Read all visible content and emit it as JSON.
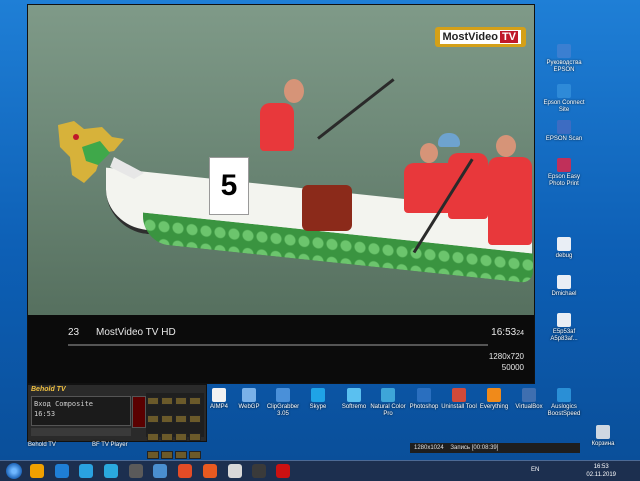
{
  "video": {
    "watermark_main": "MostVideo",
    "watermark_tv": "TV",
    "boat_number": "5",
    "osd": {
      "channel_number": "23",
      "channel_name": "MostVideo TV HD",
      "time": "16:53",
      "time_seconds": "24",
      "resolution": "1280x720",
      "bitrate": "50000"
    }
  },
  "behold": {
    "title": "Behold TV",
    "source_label": "Вход Composite",
    "clock": "16:53",
    "window_label": "Behold TV"
  },
  "recorder": {
    "resolution": "1280x1024",
    "status": "Запись [00:08:39]"
  },
  "desktop_icons_right": [
    {
      "label": "Руководства EPSON",
      "color": "#3b7fd1"
    },
    {
      "label": "Epson Connect Site",
      "color": "#2e8ad8"
    },
    {
      "label": "EPSON Scan",
      "color": "#3d6cc2"
    },
    {
      "label": "Epson Easy Photo Print",
      "color": "#c0305a"
    },
    {
      "label": "debug",
      "color": "#e9eef5"
    },
    {
      "label": "Dmichael",
      "color": "#e9eef5"
    },
    {
      "label": "E5p53af A5p83af...",
      "color": "#e9eef5"
    }
  ],
  "desktop_icons_bottom": [
    {
      "label": "AIMP4",
      "color": "#f2f2f2"
    },
    {
      "label": "WebGP",
      "color": "#7ab1e8"
    },
    {
      "label": "ClipGrabber 3.05",
      "color": "#4a90d9"
    },
    {
      "label": "Skype",
      "color": "#1fa3e6"
    },
    {
      "label": "Softremo",
      "color": "#5ac0f0"
    },
    {
      "label": "Natural Color Pro",
      "color": "#3ea5d8"
    },
    {
      "label": "Photoshop",
      "color": "#2a6fbf"
    },
    {
      "label": "Uninstall Tool",
      "color": "#d14a3a"
    },
    {
      "label": "Everything",
      "color": "#f08a1a"
    },
    {
      "label": "VirtualBox",
      "color": "#3f6fb0"
    },
    {
      "label": "Auslogics BoostSpeed",
      "color": "#2a8fd6"
    }
  ],
  "under_window_label": "BF TV Player",
  "recycle_bin": "Корзина",
  "taskbar": {
    "pinned_colors": [
      "#f0a000",
      "#1f7fd6",
      "#2aa2e0",
      "#2aa9dd",
      "#5a5a5a",
      "#4a8fd0",
      "#e34c26",
      "#e85a20",
      "#d8d8d8",
      "#3a3a3a",
      "#cc1111"
    ],
    "lang": "EN",
    "time": "16:53",
    "date": "02.11.2019"
  }
}
